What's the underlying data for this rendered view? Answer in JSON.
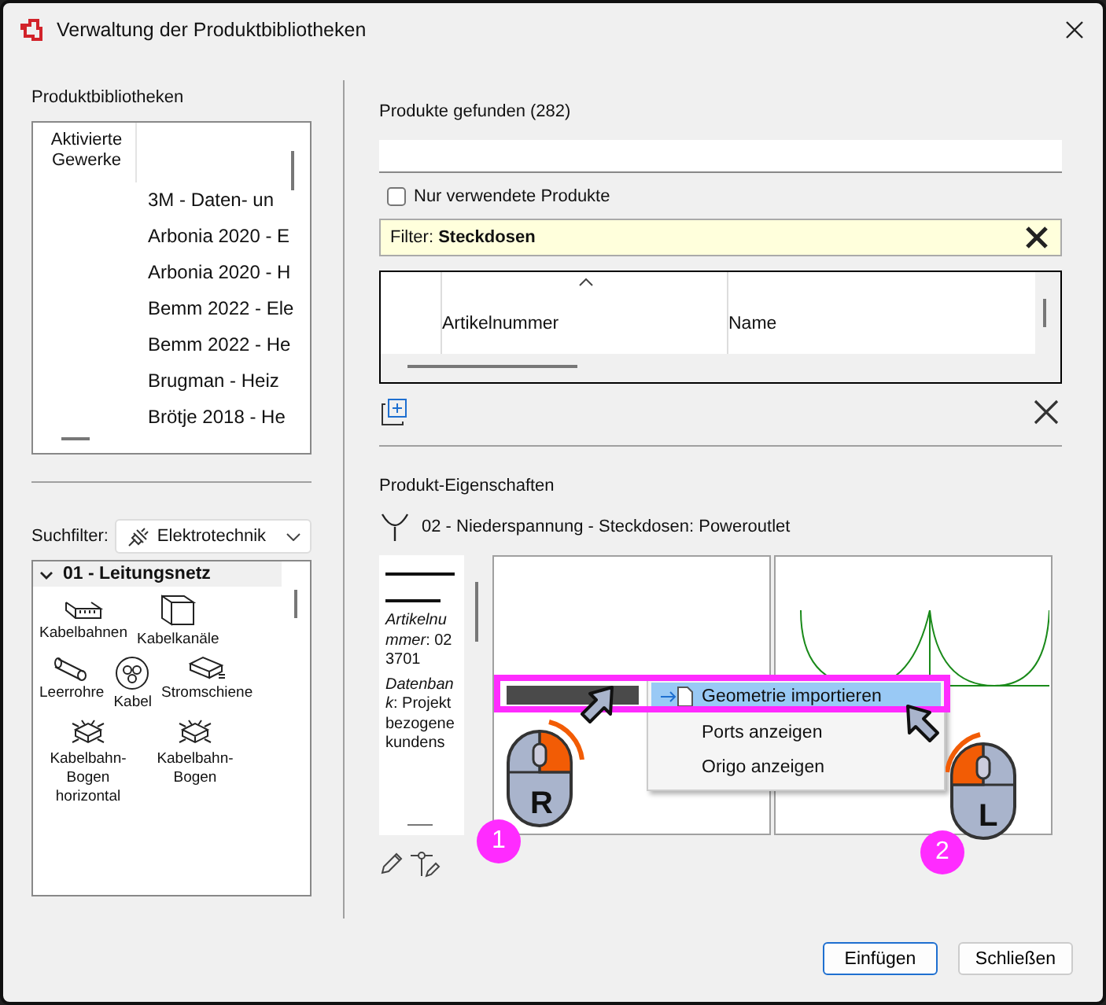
{
  "window": {
    "title": "Verwaltung der Produktbibliotheken"
  },
  "libraries": {
    "label": "Produktbibliotheken",
    "column_1": "Aktivierte Gewerke",
    "items": [
      "3M - Daten- un",
      "Arbonia 2020 - E",
      "Arbonia 2020 - H",
      "Bemm 2022 - Ele",
      "Bemm 2022 - He",
      "Brugman - Heiz",
      "Brötje 2018 - He"
    ]
  },
  "search_filter": {
    "label": "Suchfilter:",
    "value": "Elektrotechnik"
  },
  "categories": {
    "group": {
      "label": "01 - Leitungsnetz",
      "expanded": true
    },
    "items": [
      {
        "label": "Kabelbahnen",
        "kind": "tray"
      },
      {
        "label": "Kabelkanäle",
        "kind": "duct"
      },
      {
        "label": "Leerrohre",
        "kind": "conduit"
      },
      {
        "label": "Kabel",
        "kind": "cable"
      },
      {
        "label": "Stromschiene",
        "kind": "busbar"
      },
      {
        "label": "Kabelbahn-Bogen horizontal",
        "kind": "bend"
      },
      {
        "label": "Kabelbahn-Bogen",
        "kind": "bend"
      }
    ]
  },
  "products": {
    "label": "Produkte gefunden (282)",
    "only_used": {
      "label": "Nur verwendete Produkte",
      "checked": false
    },
    "filter": {
      "label": "Filter:",
      "value": "Steckdosen"
    },
    "columns": [
      {
        "label": "Artikelnummer",
        "sorted": true
      },
      {
        "label": "Name",
        "sorted": false
      }
    ]
  },
  "properties": {
    "label": "Produkt-Eigenschaften",
    "product": "02 - Niederspannung - Steckdosen: Poweroutlet",
    "details": [
      "*Artikelnummer*: 023701",
      "*Datenbank*: Projektbezogene kundens"
    ]
  },
  "context_menu": {
    "items": [
      {
        "label": "Geometrie importieren",
        "selected": true
      },
      {
        "label": "Ports anzeigen",
        "selected": false
      },
      {
        "label": "Origo anzeigen",
        "selected": false
      }
    ]
  },
  "steps": [
    {
      "number": "1",
      "button": "R"
    },
    {
      "number": "2",
      "button": "L"
    }
  ],
  "buttons": [
    {
      "label": "Einfügen",
      "default": true
    },
    {
      "label": "Schließen",
      "default": false
    }
  ]
}
